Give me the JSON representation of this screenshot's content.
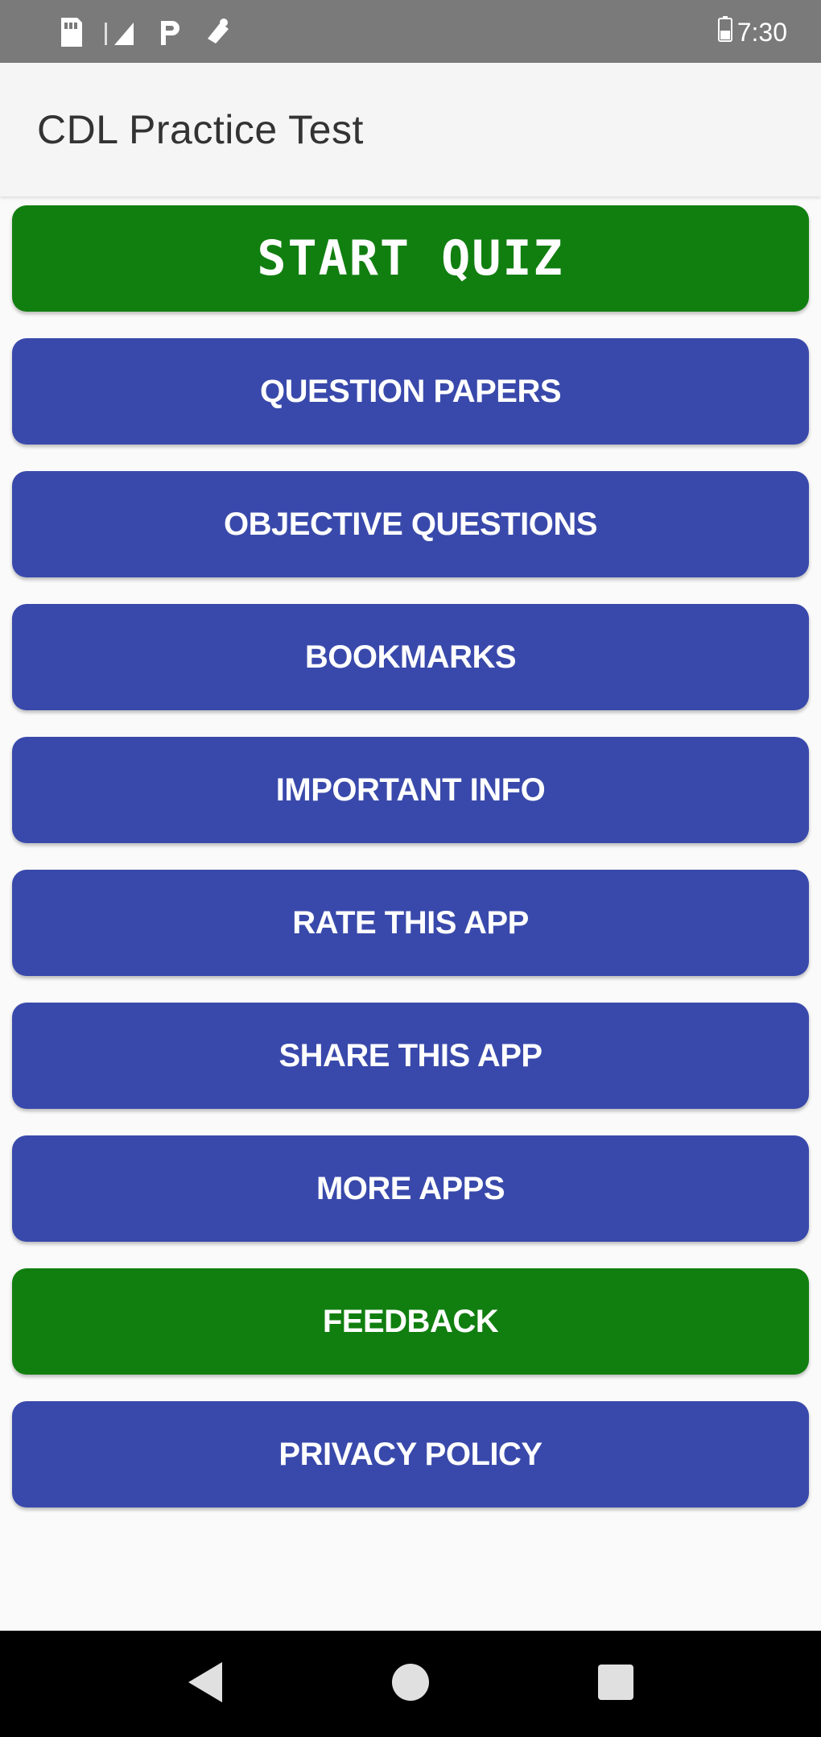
{
  "status_bar": {
    "time": "7:30",
    "icons": [
      "sd-card-icon",
      "signal-icon",
      "parking-icon",
      "notification-icon",
      "battery-icon"
    ]
  },
  "app_bar": {
    "title": "CDL Practice Test"
  },
  "menu": {
    "buttons": [
      {
        "label": "START QUIZ",
        "color": "#117f10"
      },
      {
        "label": "QUESTION PAPERS",
        "color": "#3949ab"
      },
      {
        "label": "OBJECTIVE QUESTIONS",
        "color": "#3949ab"
      },
      {
        "label": "BOOKMARKS",
        "color": "#3949ab"
      },
      {
        "label": "IMPORTANT INFO",
        "color": "#3949ab"
      },
      {
        "label": "RATE THIS APP",
        "color": "#3949ab"
      },
      {
        "label": "SHARE THIS APP",
        "color": "#3949ab"
      },
      {
        "label": "MORE APPS",
        "color": "#3949ab"
      },
      {
        "label": "FEEDBACK",
        "color": "#117f10"
      },
      {
        "label": "PRIVACY POLICY",
        "color": "#3949ab"
      }
    ]
  },
  "nav_bar": {
    "icons": [
      "back-icon",
      "home-icon",
      "recents-icon"
    ]
  }
}
